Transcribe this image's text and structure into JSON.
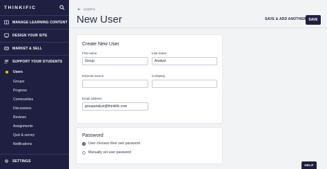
{
  "sidebar": {
    "brand": "THINKIFIC",
    "sections": [
      {
        "label": "MANAGE LEARNING CONTENT",
        "icon": "book-icon"
      },
      {
        "label": "DESIGN YOUR SITE",
        "icon": "brush-icon"
      },
      {
        "label": "MARKET & SELL",
        "icon": "tag-icon"
      },
      {
        "label": "SUPPORT YOUR STUDENTS",
        "icon": "people-icon"
      }
    ],
    "items": [
      "Users",
      "Groups",
      "Progress",
      "Communities",
      "Discussions",
      "Reviews",
      "Assignments",
      "Quiz & survey",
      "Notifications"
    ],
    "settings": "SETTINGS",
    "active_dot_color": "#f3c21b",
    "bg_color": "#1f2041"
  },
  "header": {
    "breadcrumb": "USERS",
    "title": "New User",
    "save_add_label": "SAVE & ADD ANOTHER",
    "save_label": "SAVE"
  },
  "form": {
    "section_title": "Create New User",
    "first_name_label": "First name",
    "first_name_value": "Group",
    "last_name_label": "Last name",
    "last_name_value": "Analyst",
    "external_source_label": "External source",
    "external_source_value": "",
    "company_label": "Company",
    "company_value": "",
    "email_label": "Email address",
    "email_value": "groupanalyst@thinkific.com"
  },
  "password": {
    "section_title": "Password",
    "option_1": "User chooses their own password",
    "option_2": "Manually set user password"
  },
  "help_label": "HELP"
}
